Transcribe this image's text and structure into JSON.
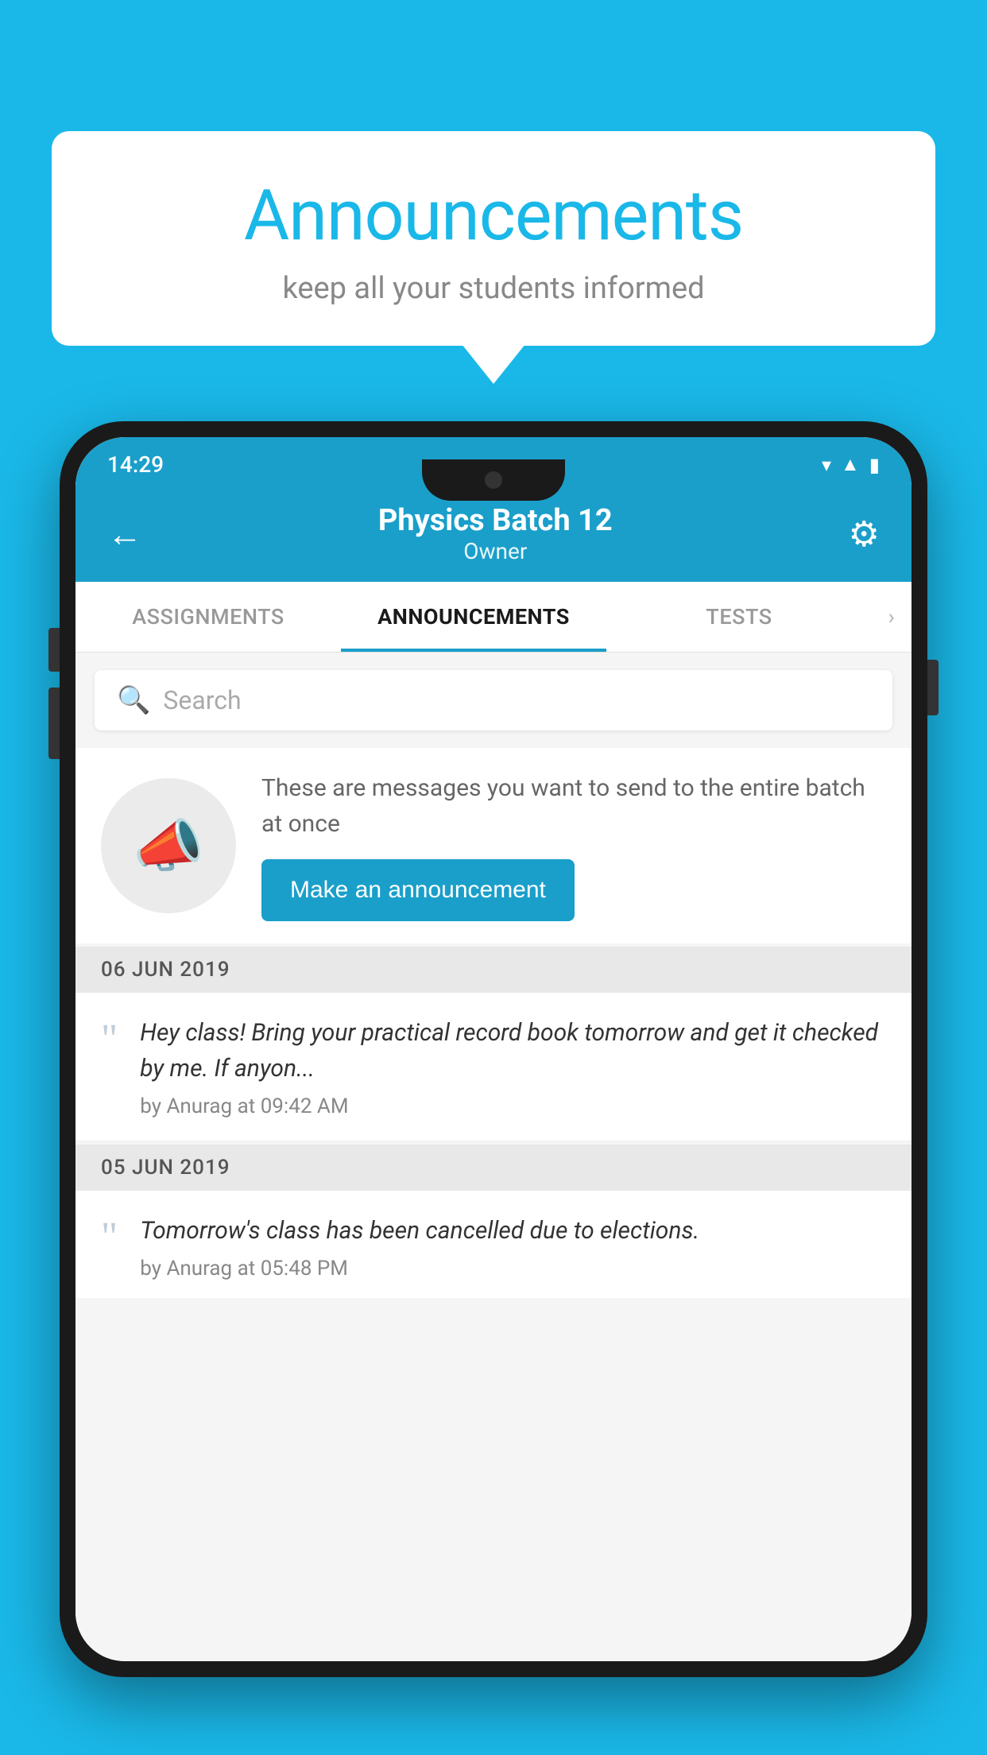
{
  "background_color": "#1ab8e8",
  "speech_bubble": {
    "title": "Announcements",
    "subtitle": "keep all your students informed"
  },
  "phone": {
    "status_bar": {
      "time": "14:29",
      "icons": [
        "wifi",
        "signal",
        "battery"
      ]
    },
    "app_bar": {
      "title": "Physics Batch 12",
      "subtitle": "Owner",
      "back_label": "←",
      "settings_label": "⚙"
    },
    "tabs": [
      {
        "label": "ASSIGNMENTS",
        "active": false
      },
      {
        "label": "ANNOUNCEMENTS",
        "active": true
      },
      {
        "label": "TESTS",
        "active": false
      },
      {
        "label": "",
        "active": false
      }
    ],
    "search": {
      "placeholder": "Search"
    },
    "promo": {
      "description": "These are messages you want to send to the entire batch at once",
      "button_label": "Make an announcement"
    },
    "announcements": [
      {
        "date": "06  JUN  2019",
        "text": "Hey class! Bring your practical record book tomorrow and get it checked by me. If anyon...",
        "by": "by Anurag at 09:42 AM"
      },
      {
        "date": "05  JUN  2019",
        "text": "Tomorrow's class has been cancelled due to elections.",
        "by": "by Anurag at 05:48 PM"
      }
    ]
  }
}
